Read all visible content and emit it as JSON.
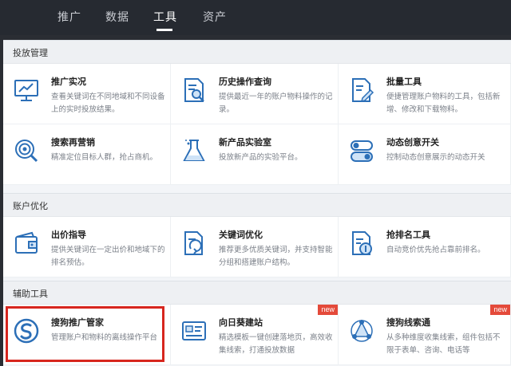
{
  "nav": {
    "items": [
      "推广",
      "数据",
      "工具",
      "资产"
    ],
    "active": "工具"
  },
  "sections": [
    {
      "title": "投放管理",
      "cards": [
        {
          "title": "推广实况",
          "desc": "查看关键词在不同地域和不同设备上的实时投放结果。",
          "icon": "monitor-chart-icon"
        },
        {
          "title": "历史操作查询",
          "desc": "提供最近一年的账户物料操作的记录。",
          "icon": "history-search-icon"
        },
        {
          "title": "批量工具",
          "desc": "便捷管理账户物料的工具，包括新增、修改和下载物料。",
          "icon": "batch-tool-icon"
        },
        {
          "title": "搜索再营销",
          "desc": "精准定位目标人群，抢占商机。",
          "icon": "target-search-icon"
        },
        {
          "title": "新产品实验室",
          "desc": "投放新产品的实验平台。",
          "icon": "flask-icon"
        },
        {
          "title": "动态创意开关",
          "desc": "控制动态创意展示的动态开关",
          "icon": "toggle-switch-icon"
        }
      ]
    },
    {
      "title": "账户优化",
      "cards": [
        {
          "title": "出价指导",
          "desc": "提供关键词在一定出价和地域下的排名预估。",
          "icon": "wallet-icon"
        },
        {
          "title": "关键词优化",
          "desc": "推荐更多优质关键词，并支持智能分组和搭建账户结构。",
          "icon": "keyword-optimize-icon"
        },
        {
          "title": "抢排名工具",
          "desc": "自动竞价优先抢占靠前排名。",
          "icon": "rank-grab-icon"
        }
      ]
    },
    {
      "title": "辅助工具",
      "cards": [
        {
          "title": "搜狗推广管家",
          "desc": "管理账户和物料的离线操作平台",
          "icon": "sogou-logo-icon",
          "badge": ""
        },
        {
          "title": "向日葵建站",
          "desc": "精选模板一键创建落地页，高效收集线索，打通投放数据",
          "icon": "site-builder-icon",
          "badge": "new"
        },
        {
          "title": "搜狗线索通",
          "desc": "从多种维度收集线索，组件包括不限于表单、咨询、电话等",
          "icon": "lead-share-icon",
          "badge": "new"
        }
      ]
    }
  ]
}
